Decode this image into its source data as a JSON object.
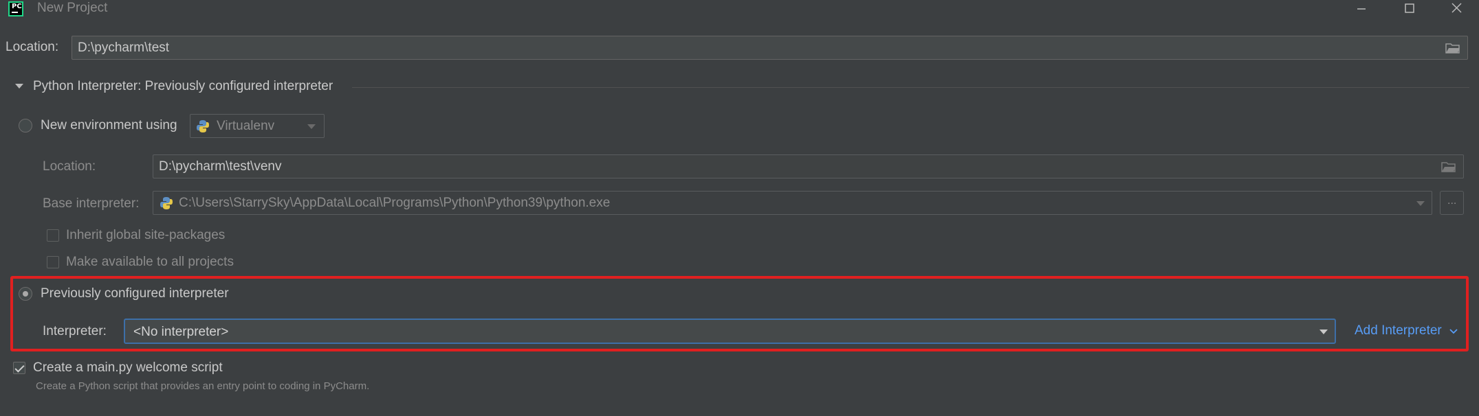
{
  "window": {
    "title": "New Project",
    "app_icon_text": "PC"
  },
  "location": {
    "label": "Location:",
    "value": "D:\\pycharm\\test"
  },
  "interpreter_section": {
    "title": "Python Interpreter: Previously configured interpreter"
  },
  "new_env": {
    "label": "New environment using",
    "tool": "Virtualenv",
    "location_label": "Location:",
    "location_value": "D:\\pycharm\\test\\venv",
    "base_label": "Base interpreter:",
    "base_value": "C:\\Users\\StarrySky\\AppData\\Local\\Programs\\Python\\Python39\\python.exe",
    "more_button": "...",
    "inherit_label": "Inherit global site-packages",
    "make_available_label": "Make available to all projects"
  },
  "previous": {
    "label": "Previously configured interpreter",
    "interpreter_label": "Interpreter:",
    "interpreter_value": "<No interpreter>",
    "add_interpreter": "Add Interpreter"
  },
  "welcome": {
    "label": "Create a main.py welcome script",
    "description": "Create a Python script that provides an entry point to coding in PyCharm."
  },
  "colors": {
    "background": "#3c3f41",
    "highlight_border": "#e02020",
    "focus_border": "#3d6fa8",
    "link": "#589df6"
  }
}
